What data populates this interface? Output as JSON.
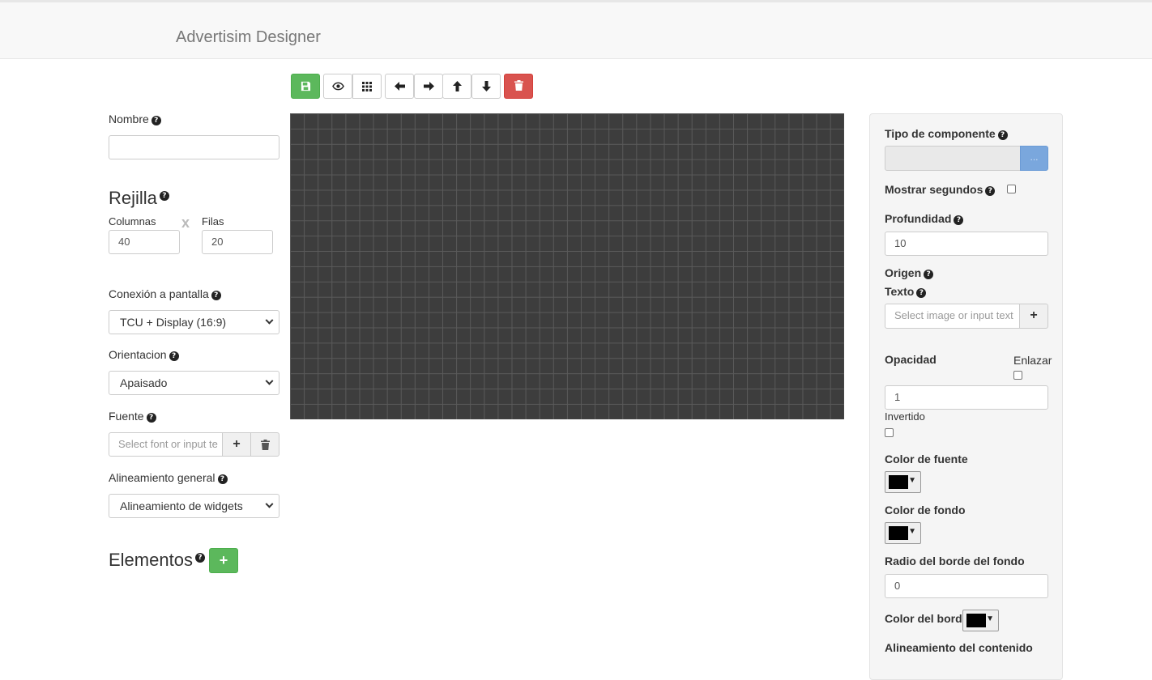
{
  "app": {
    "title": "Advertisim Designer"
  },
  "toolbar": {
    "save": "save-icon",
    "preview": "eye-icon",
    "grid": "grid-icon",
    "left": "arrow-left-icon",
    "right": "arrow-right-icon",
    "up": "arrow-up-icon",
    "down": "arrow-down-icon",
    "delete": "trash-icon"
  },
  "left": {
    "nombre_label": "Nombre",
    "nombre_value": "",
    "rejilla_title": "Rejilla",
    "columnas_label": "Columnas",
    "columnas_value": "40",
    "x_sep": "x",
    "filas_label": "Filas",
    "filas_value": "20",
    "conexion_label": "Conexión a pantalla",
    "conexion_value": "TCU + Display (16:9)",
    "orientacion_label": "Orientacion",
    "orientacion_value": "Apaisado",
    "fuente_label": "Fuente",
    "fuente_placeholder": "Select font or input te",
    "alineamiento_label": "Alineamiento general",
    "alineamiento_value": "Alineamiento de widgets",
    "elementos_title": "Elementos"
  },
  "right": {
    "tipo_label": "Tipo de componente",
    "tipo_value": "",
    "tipo_button": "...",
    "mostrar_label": "Mostrar segundos",
    "profundidad_label": "Profundidad",
    "profundidad_value": "10",
    "origen_label": "Origen",
    "texto_label": "Texto",
    "texto_placeholder": "Select image or input text",
    "opacidad_label": "Opacidad",
    "enlazar_label": "Enlazar",
    "opacidad_value": "1",
    "invertido_label": "Invertido",
    "color_fuente_label": "Color de fuente",
    "color_fuente": "#000000",
    "color_fondo_label": "Color de fondo",
    "color_fondo": "#000000",
    "radio_label": "Radio del borde del fondo",
    "radio_value": "0",
    "color_borde_label": "Color del borde",
    "color_borde": "#000000",
    "alineamiento_contenido_label": "Alineamiento del contenido"
  },
  "colors": {
    "canvas": "#3d3d3d",
    "success": "#5cb85c",
    "danger": "#d9534f",
    "info": "#7aa7dd"
  }
}
